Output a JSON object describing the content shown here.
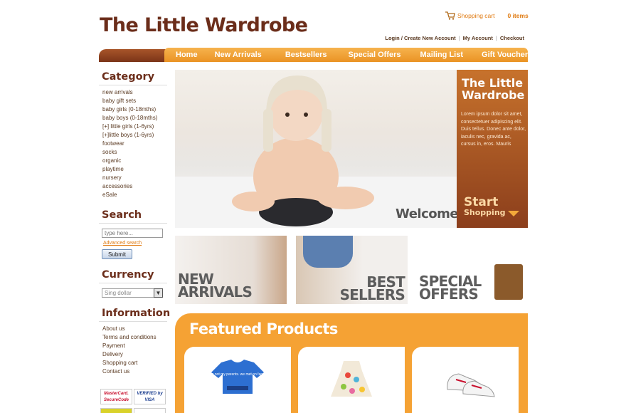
{
  "header": {
    "logo": "The Little Wardrobe",
    "cart_label": "Shopping cart",
    "cart_count": "0 items",
    "links": [
      "Login / Create New Account",
      "My Account",
      "Checkout"
    ]
  },
  "nav": {
    "items": [
      "Home",
      "New Arrivals",
      "Bestsellers",
      "Special Offers",
      "Mailing List",
      "Gift Voucher FAQ"
    ]
  },
  "sidebar": {
    "category_heading": "Category",
    "categories": [
      "new arrivals",
      "baby gift sets",
      "baby girls (0-18mths)",
      "baby boys (0-18mths)",
      "[+] little girls (1-6yrs)",
      "[+]little boys (1-6yrs)",
      "footwear",
      "socks",
      "organic",
      "playtime",
      "nursery",
      "accessories",
      "eSale"
    ],
    "search_heading": "Search",
    "search_placeholder": "type here...",
    "advanced_search": "Advanced search",
    "submit_label": "Submit",
    "currency_heading": "Currency",
    "currency_value": "Sing dollar",
    "information_heading": "Information",
    "information_links": [
      "About us",
      "Terms and conditions",
      "Payment",
      "Delivery",
      "Shopping cart",
      "Contact us"
    ],
    "cards": [
      "MasterCard. SecureCode",
      "VERIFIED by VISA"
    ]
  },
  "hero": {
    "title": "The Little Wardrobe",
    "text": "Lorem ipsum dolor sit amet, consectetuer adipiscing elit. Duis tellus. Donec ante dolor, iaculis nec, gravida ac, cursus in, eros. Mauris",
    "cta_line1": "Start",
    "cta_line2": "Shopping",
    "welcome": "Welcome"
  },
  "promos": {
    "new_line1": "NEW",
    "new_line2": "ARRIVALS",
    "best_line1": "BEST",
    "best_line2": "SELLERS",
    "special_line1": "SPECIAL",
    "special_line2": "OFFERS"
  },
  "featured": {
    "title": "Featured Products",
    "products": [
      "they're not my parents, we met on facebook t-shirt",
      "polka dot baby dress",
      "baby sneakers"
    ],
    "tshirt_text": "they're not my parents. we met on facebook"
  },
  "colors": {
    "brand_brown": "#6b2d1a",
    "accent_orange": "#f5a234",
    "link_orange": "#e07a10"
  }
}
